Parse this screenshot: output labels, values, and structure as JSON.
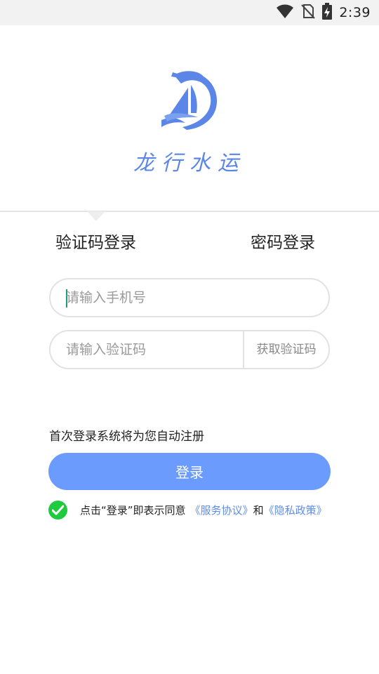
{
  "status_bar": {
    "time": "2:39",
    "icons": [
      "wifi-icon",
      "no-sim-icon",
      "battery-charging-icon"
    ]
  },
  "logo": {
    "brand_name": "龙行水运",
    "icon": "dragon-sailboat-logo",
    "color": "#5b86e8"
  },
  "tabs": [
    {
      "label": "验证码登录",
      "active": true
    },
    {
      "label": "密码登录",
      "active": false
    }
  ],
  "phone_field": {
    "placeholder": "请输入手机号",
    "value": ""
  },
  "code_field": {
    "placeholder": "请输入验证码",
    "value": "",
    "get_code_label": "获取验证码"
  },
  "hint": "首次登录系统将为您自动注册",
  "login_button": {
    "label": "登录",
    "color": "#6b9bfc"
  },
  "agreement": {
    "checked": true,
    "prefix": "点击“登录”即表示同意",
    "service_link": "《服务协议》",
    "conjunction": "和",
    "privacy_link": "《隐私政策》",
    "check_color": "#1fcb3e",
    "link_color": "#5b8def"
  }
}
